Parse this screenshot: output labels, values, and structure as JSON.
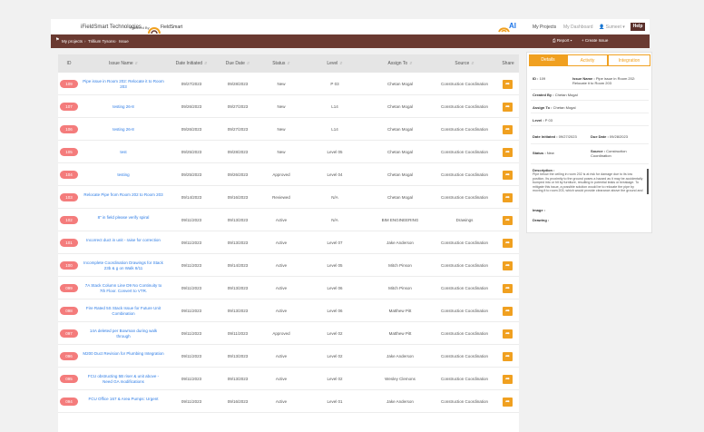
{
  "header": {
    "company": "iFieldSmart Technologies",
    "powered_by": "Powered By",
    "logo_text": "FieldSmart",
    "ai_logo": "AI",
    "nav": {
      "my_projects": "My Projects",
      "my_dashboard": "My Dashboard",
      "user": "Sumeet",
      "help": "Help"
    }
  },
  "breadcrumb": {
    "items": [
      "My projects",
      "Trillium Tysons",
      "Issue"
    ],
    "report": "Report",
    "create": "Create Issue"
  },
  "table": {
    "columns": [
      "ID",
      "Issue Name",
      "Date Initiated",
      "Due Date",
      "Status",
      "Level",
      "Assign To",
      "Source",
      "Share"
    ],
    "rows": [
      {
        "id": "109",
        "name": "Pipe issue in Room 202: Relocate it to Room 203",
        "initiated": "09/27/2023",
        "due": "09/28/2023",
        "status": "New",
        "level": "P 03",
        "assign": "Chetan Mogal",
        "source": "Construction Coordination"
      },
      {
        "id": "107",
        "name": "testing 26-8",
        "initiated": "09/26/2023",
        "due": "09/27/2023",
        "status": "New",
        "level": "L14",
        "assign": "Chetan Mogal",
        "source": "Construction Coordination"
      },
      {
        "id": "106",
        "name": "testing 26-8",
        "initiated": "09/26/2023",
        "due": "09/27/2023",
        "status": "New",
        "level": "L14",
        "assign": "Chetan Mogal",
        "source": "Construction Coordination"
      },
      {
        "id": "105",
        "name": "test",
        "initiated": "09/25/2023",
        "due": "09/28/2023",
        "status": "New",
        "level": "Level 05",
        "assign": "Chetan Mogal",
        "source": "Construction Coordination"
      },
      {
        "id": "104",
        "name": "testing",
        "initiated": "09/25/2023",
        "due": "09/26/2023",
        "status": "Approved",
        "level": "Level 04",
        "assign": "Chetan Mogal",
        "source": "Construction Coordination"
      },
      {
        "id": "103",
        "name": "Relocate Pipe from Room 202 to Room 203",
        "initiated": "09/14/2023",
        "due": "09/16/2023",
        "status": "Reviewed",
        "level": "N/A",
        "assign": "Chetan Mogal",
        "source": "Construction Coordination"
      },
      {
        "id": "102",
        "name": "8\" in field please verify spiral",
        "initiated": "09/11/2023",
        "due": "09/13/2023",
        "status": "Active",
        "level": "N/A",
        "assign": "BIM ENGINEERING",
        "source": "Drawings"
      },
      {
        "id": "101",
        "name": "Incorrect duct in unit - raise for correction",
        "initiated": "09/11/2023",
        "due": "09/13/2023",
        "status": "Active",
        "level": "Level 07",
        "assign": "Jake Anderson",
        "source": "Construction Coordination"
      },
      {
        "id": "100",
        "name": "Incomplete Coordination Drawings for Stack 23b & g on Walk 8/11",
        "initiated": "09/11/2023",
        "due": "09/14/2023",
        "status": "Active",
        "level": "Level 05",
        "assign": "Mitch Pinson",
        "source": "Construction Coordination"
      },
      {
        "id": "099",
        "name": "7A Stack Column Line D9 No Continuity to 7th Floor. Convert to VTR.",
        "initiated": "09/11/2023",
        "due": "09/13/2023",
        "status": "Active",
        "level": "Level 06",
        "assign": "Mitch Pinson",
        "source": "Construction Coordination"
      },
      {
        "id": "098",
        "name": "Fire Rated 5S Stack Issue for Future Unit Combination",
        "initiated": "09/11/2023",
        "due": "09/13/2023",
        "status": "Active",
        "level": "Level 06",
        "assign": "Matthew Pitt",
        "source": "Construction Coordination"
      },
      {
        "id": "097",
        "name": "14A deleted per Bowman during walk through",
        "initiated": "09/11/2023",
        "due": "09/11/2023",
        "status": "Approved",
        "level": "Level 02",
        "assign": "Matthew Pitt",
        "source": "Construction Coordination"
      },
      {
        "id": "096",
        "name": "M200 Duct Revision for Plumbing Integration",
        "initiated": "09/11/2023",
        "due": "09/13/2023",
        "status": "Active",
        "level": "Level 02",
        "assign": "Jake Anderson",
        "source": "Construction Coordination"
      },
      {
        "id": "095",
        "name": "FCU obstructing 5B riser & unit above - Need GA modifications",
        "initiated": "09/11/2023",
        "due": "09/13/2023",
        "status": "Active",
        "level": "Level 02",
        "assign": "Wesley Clemons",
        "source": "Construction Coordination"
      },
      {
        "id": "094",
        "name": "FCU Office 167 & Area Pumps: Urgent",
        "initiated": "09/11/2023",
        "due": "09/16/2023",
        "status": "Active",
        "level": "Level 01",
        "assign": "Jake Anderson",
        "source": "Construction Coordination"
      }
    ]
  },
  "detail": {
    "tabs": [
      "Details",
      "Activity",
      "Integration"
    ],
    "id_label": "ID :",
    "id_value": "109",
    "issue_name_label": "Issue Name :",
    "issue_name_value": "Pipe issue in Room 202: Relocate it to Room 203",
    "created_by_label": "Created By :",
    "created_by_value": "Chetan Mogal",
    "assign_to_label": "Assign To :",
    "assign_to_value": "Chetan Mogal",
    "level_label": "Level :",
    "level_value": "P 03",
    "date_initiated_label": "Date Initiated :",
    "date_initiated_value": "09/27/2023",
    "due_date_label": "Due Date :",
    "due_date_value": "09/28/2023",
    "status_label": "Status :",
    "status_value": "New",
    "source_label": "Source :",
    "source_value": "Construction Coordination",
    "description_label": "Description :",
    "description_value": "Pipe below the ceiling in room 202 is at risk for damage due to its low position. Its proximity to the ground poses a hazard as it may be accidentally bumped into or hit by furniture, resulting in potential leaks or breakage. To mitigate this issue, a possible solution would be to relocate the pipe by moving it to room 203, which would provide clearance above the ground and",
    "image_label": "Image :",
    "drawing_label": "Drawing :"
  },
  "colors": {
    "brand_brown": "#6a3a31",
    "accent_orange": "#f0a020",
    "id_pill": "#f47c7c",
    "link_blue": "#2c7be5"
  }
}
